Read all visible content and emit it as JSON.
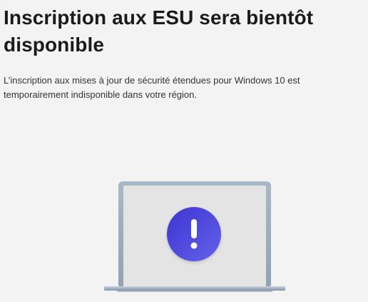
{
  "page": {
    "title": "Inscription aux ESU sera bientôt disponible",
    "description": "L’inscription aux mises à jour de sécurité étendues pour Windows 10 est temporairement indisponible dans votre région."
  },
  "illustration": {
    "icon": "laptop-with-exclamation-icon",
    "badge_icon": "exclamation-icon",
    "colors": {
      "background": "#f3f3f3",
      "laptop_frame": "#9daec0",
      "laptop_screen": "#e4e4e4",
      "badge_start": "#4b3fd8",
      "badge_end": "#5f5be6"
    }
  }
}
